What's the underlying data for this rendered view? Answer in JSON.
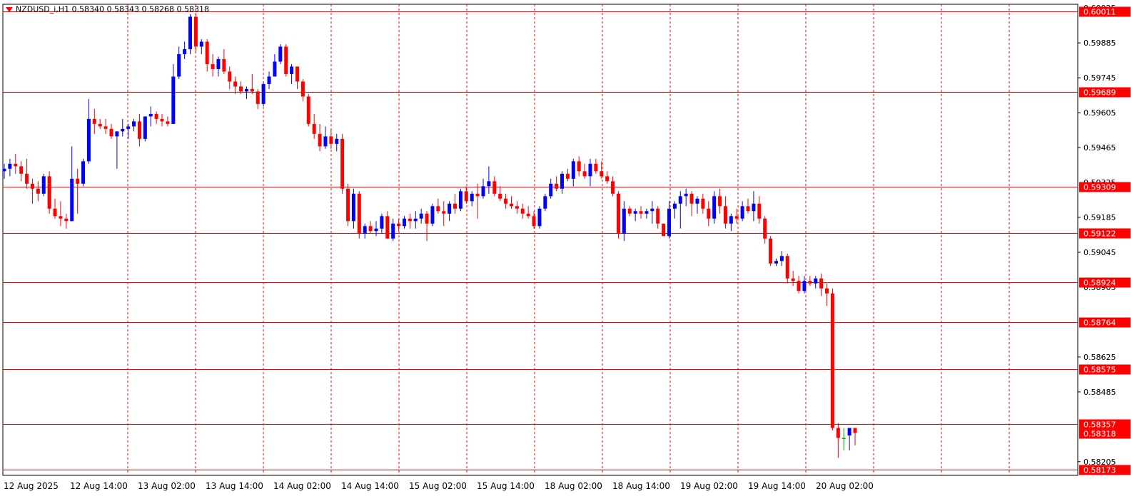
{
  "header": {
    "symbol_info": "NZDUSD_i,H1  0.58340 0.58343 0.58268 0.58318"
  },
  "colors": {
    "bull": "#0000ff",
    "bear": "#ff0000",
    "neutral": "#00aa00",
    "level_line": "#ff0000",
    "grid": "#ff0000",
    "axis_text": "#000000",
    "badge_bg": "#ff0000",
    "badge_text": "#ffffff"
  },
  "chart_data": {
    "type": "candlestick",
    "title": "",
    "ylim": [
      0.5815,
      0.6004
    ],
    "y_ticks": [
      "0.59885",
      "0.59745",
      "0.59605",
      "0.59465",
      "0.59185",
      "0.59045",
      "0.58625",
      "0.58485",
      "0.58205"
    ],
    "y_ticks_partial": [
      "0.60025",
      "0.59325",
      "0.58905"
    ],
    "x_ticks": [
      "12 Aug 2025",
      "12 Aug 14:00",
      "13 Aug 02:00",
      "13 Aug 14:00",
      "14 Aug 02:00",
      "14 Aug 14:00",
      "15 Aug 02:00",
      "15 Aug 14:00",
      "18 Aug 02:00",
      "18 Aug 14:00",
      "19 Aug 02:00",
      "19 Aug 14:00",
      "20 Aug 02:00"
    ],
    "horizontal_levels": [
      "0.60011",
      "0.59689",
      "0.59309",
      "0.59122",
      "0.58924",
      "0.58764",
      "0.58575",
      "0.58357",
      "0.58173"
    ],
    "current_price": "0.58318",
    "grid": "vertical dashed",
    "candles": [
      [
        0.5937,
        0.594,
        0.5934,
        0.5938
      ],
      [
        0.5938,
        0.5942,
        0.5935,
        0.594
      ],
      [
        0.594,
        0.5944,
        0.5936,
        0.5939
      ],
      [
        0.5939,
        0.5941,
        0.5933,
        0.5936
      ],
      [
        0.5936,
        0.5942,
        0.593,
        0.5932
      ],
      [
        0.5932,
        0.5934,
        0.5924,
        0.593
      ],
      [
        0.593,
        0.5933,
        0.5925,
        0.5928
      ],
      [
        0.5928,
        0.5936,
        0.5927,
        0.5935
      ],
      [
        0.5935,
        0.5937,
        0.592,
        0.5922
      ],
      [
        0.5922,
        0.5926,
        0.5918,
        0.5919
      ],
      [
        0.5919,
        0.5925,
        0.5915,
        0.5918
      ],
      [
        0.5918,
        0.592,
        0.5914,
        0.5917
      ],
      [
        0.5917,
        0.5947,
        0.5917,
        0.5934
      ],
      [
        0.5934,
        0.5938,
        0.592,
        0.5932
      ],
      [
        0.5932,
        0.5942,
        0.5931,
        0.5941
      ],
      [
        0.5941,
        0.5966,
        0.594,
        0.5958
      ],
      [
        0.5958,
        0.5962,
        0.5952,
        0.5956
      ],
      [
        0.5956,
        0.5958,
        0.5954,
        0.5955
      ],
      [
        0.5955,
        0.5958,
        0.5952,
        0.5954
      ],
      [
        0.5954,
        0.5956,
        0.595,
        0.5951
      ],
      [
        0.5951,
        0.5953,
        0.5938,
        0.5953
      ],
      [
        0.5953,
        0.5958,
        0.5951,
        0.5954
      ],
      [
        0.5954,
        0.5956,
        0.595,
        0.5955
      ],
      [
        0.5955,
        0.5958,
        0.5953,
        0.5957
      ],
      [
        0.5957,
        0.596,
        0.5947,
        0.595
      ],
      [
        0.595,
        0.5957,
        0.5949,
        0.5959
      ],
      [
        0.5959,
        0.5963,
        0.5955,
        0.596
      ],
      [
        0.596,
        0.5961,
        0.5956,
        0.5958
      ],
      [
        0.5958,
        0.596,
        0.5955,
        0.5957
      ],
      [
        0.5957,
        0.5959,
        0.5955,
        0.5956
      ],
      [
        0.5956,
        0.598,
        0.5956,
        0.5975
      ],
      [
        0.5975,
        0.5987,
        0.5974,
        0.5984
      ],
      [
        0.5984,
        0.5989,
        0.5982,
        0.5986
      ],
      [
        0.5986,
        0.6,
        0.5984,
        0.5999
      ],
      [
        0.5999,
        0.6,
        0.5985,
        0.5987
      ],
      [
        0.5987,
        0.599,
        0.5984,
        0.5989
      ],
      [
        0.5989,
        0.599,
        0.5977,
        0.598
      ],
      [
        0.598,
        0.5984,
        0.5975,
        0.5978
      ],
      [
        0.5978,
        0.5983,
        0.5975,
        0.5982
      ],
      [
        0.5982,
        0.5986,
        0.5976,
        0.5977
      ],
      [
        0.5977,
        0.5979,
        0.597,
        0.5973
      ],
      [
        0.5973,
        0.5975,
        0.5968,
        0.5971
      ],
      [
        0.5971,
        0.5973,
        0.5968,
        0.5969
      ],
      [
        0.5969,
        0.5971,
        0.5966,
        0.597
      ],
      [
        0.597,
        0.5976,
        0.5968,
        0.5969
      ],
      [
        0.5969,
        0.597,
        0.5962,
        0.5964
      ],
      [
        0.5964,
        0.5973,
        0.5963,
        0.5972
      ],
      [
        0.5972,
        0.5977,
        0.597,
        0.5975
      ],
      [
        0.5975,
        0.5984,
        0.5975,
        0.5981
      ],
      [
        0.5981,
        0.5988,
        0.598,
        0.5987
      ],
      [
        0.5987,
        0.5988,
        0.5975,
        0.5976
      ],
      [
        0.5976,
        0.598,
        0.5972,
        0.5979
      ],
      [
        0.5979,
        0.5979,
        0.597,
        0.5973
      ],
      [
        0.5973,
        0.5974,
        0.5965,
        0.5967
      ],
      [
        0.5967,
        0.5968,
        0.5955,
        0.5956
      ],
      [
        0.5956,
        0.596,
        0.595,
        0.5952
      ],
      [
        0.5952,
        0.5956,
        0.5945,
        0.5947
      ],
      [
        0.5947,
        0.5955,
        0.5946,
        0.5951
      ],
      [
        0.5951,
        0.5954,
        0.5946,
        0.5948
      ],
      [
        0.5948,
        0.5952,
        0.5945,
        0.595
      ],
      [
        0.595,
        0.5952,
        0.5928,
        0.593
      ],
      [
        0.593,
        0.5932,
        0.5915,
        0.5917
      ],
      [
        0.5917,
        0.593,
        0.5914,
        0.5928
      ],
      [
        0.5928,
        0.5929,
        0.591,
        0.5912
      ],
      [
        0.5912,
        0.5916,
        0.591,
        0.5915
      ],
      [
        0.5915,
        0.5917,
        0.5912,
        0.5913
      ],
      [
        0.5913,
        0.5917,
        0.5911,
        0.5914
      ],
      [
        0.5914,
        0.592,
        0.5912,
        0.5919
      ],
      [
        0.5919,
        0.5921,
        0.591,
        0.591
      ],
      [
        0.591,
        0.5918,
        0.5909,
        0.5916
      ],
      [
        0.5916,
        0.5918,
        0.5913,
        0.5915
      ],
      [
        0.5915,
        0.5919,
        0.5914,
        0.5918
      ],
      [
        0.5918,
        0.592,
        0.5914,
        0.5917
      ],
      [
        0.5917,
        0.5921,
        0.5914,
        0.5918
      ],
      [
        0.5918,
        0.5922,
        0.5916,
        0.592
      ],
      [
        0.592,
        0.5921,
        0.5909,
        0.5916
      ],
      [
        0.5916,
        0.5924,
        0.5915,
        0.5923
      ],
      [
        0.5923,
        0.5926,
        0.592,
        0.5921
      ],
      [
        0.5921,
        0.5925,
        0.5915,
        0.592
      ],
      [
        0.592,
        0.5925,
        0.5917,
        0.5924
      ],
      [
        0.5924,
        0.5928,
        0.592,
        0.5922
      ],
      [
        0.5922,
        0.593,
        0.5921,
        0.5929
      ],
      [
        0.5929,
        0.5931,
        0.5924,
        0.5925
      ],
      [
        0.5925,
        0.5929,
        0.5923,
        0.5928
      ],
      [
        0.5928,
        0.5932,
        0.5918,
        0.5927
      ],
      [
        0.5927,
        0.5934,
        0.5926,
        0.5931
      ],
      [
        0.5931,
        0.5939,
        0.5928,
        0.5933
      ],
      [
        0.5933,
        0.5935,
        0.5927,
        0.5928
      ],
      [
        0.5928,
        0.5931,
        0.5925,
        0.5926
      ],
      [
        0.5926,
        0.5928,
        0.5922,
        0.5924
      ],
      [
        0.5924,
        0.5927,
        0.5922,
        0.5923
      ],
      [
        0.5923,
        0.5925,
        0.592,
        0.5922
      ],
      [
        0.5922,
        0.5924,
        0.5918,
        0.592
      ],
      [
        0.592,
        0.5923,
        0.5918,
        0.5919
      ],
      [
        0.5919,
        0.5921,
        0.5914,
        0.5915
      ],
      [
        0.5915,
        0.5923,
        0.5914,
        0.5922
      ],
      [
        0.5922,
        0.5928,
        0.5921,
        0.5927
      ],
      [
        0.5927,
        0.5934,
        0.5926,
        0.5932
      ],
      [
        0.5932,
        0.5935,
        0.5929,
        0.593
      ],
      [
        0.593,
        0.5937,
        0.5928,
        0.5936
      ],
      [
        0.5936,
        0.5938,
        0.5933,
        0.5934
      ],
      [
        0.5934,
        0.5942,
        0.5931,
        0.5941
      ],
      [
        0.5941,
        0.5943,
        0.5935,
        0.5937
      ],
      [
        0.5937,
        0.594,
        0.5934,
        0.5935
      ],
      [
        0.5935,
        0.5942,
        0.5931,
        0.594
      ],
      [
        0.594,
        0.5942,
        0.5936,
        0.5937
      ],
      [
        0.5937,
        0.5941,
        0.5934,
        0.5935
      ],
      [
        0.5935,
        0.5937,
        0.5932,
        0.5933
      ],
      [
        0.5933,
        0.5935,
        0.5927,
        0.5928
      ],
      [
        0.5928,
        0.5929,
        0.591,
        0.5912
      ],
      [
        0.5912,
        0.5925,
        0.5909,
        0.5922
      ],
      [
        0.5922,
        0.5923,
        0.5919,
        0.592
      ],
      [
        0.592,
        0.5922,
        0.5917,
        0.5921
      ],
      [
        0.5921,
        0.5923,
        0.5918,
        0.592
      ],
      [
        0.592,
        0.5922,
        0.5918,
        0.5921
      ],
      [
        0.5921,
        0.5925,
        0.5916,
        0.5922
      ],
      [
        0.5922,
        0.5923,
        0.5914,
        0.5916
      ],
      [
        0.5916,
        0.5916,
        0.5911,
        0.5911
      ],
      [
        0.5911,
        0.5925,
        0.591,
        0.5922
      ],
      [
        0.5922,
        0.5925,
        0.5918,
        0.5924
      ],
      [
        0.5924,
        0.5929,
        0.5914,
        0.5927
      ],
      [
        0.5927,
        0.593,
        0.5923,
        0.5928
      ],
      [
        0.5928,
        0.5929,
        0.5919,
        0.5924
      ],
      [
        0.5924,
        0.5927,
        0.592,
        0.5926
      ],
      [
        0.5926,
        0.5928,
        0.592,
        0.5922
      ],
      [
        0.5922,
        0.5925,
        0.5915,
        0.5918
      ],
      [
        0.5918,
        0.5929,
        0.5916,
        0.5927
      ],
      [
        0.5927,
        0.593,
        0.592,
        0.5923
      ],
      [
        0.5923,
        0.5927,
        0.5914,
        0.5916
      ],
      [
        0.5916,
        0.592,
        0.5913,
        0.5919
      ],
      [
        0.5919,
        0.5922,
        0.5916,
        0.5918
      ],
      [
        0.5918,
        0.5925,
        0.5917,
        0.5923
      ],
      [
        0.5923,
        0.5926,
        0.592,
        0.5921
      ],
      [
        0.5921,
        0.5929,
        0.5917,
        0.5924
      ],
      [
        0.5924,
        0.5927,
        0.5916,
        0.5918
      ],
      [
        0.5918,
        0.5919,
        0.5908,
        0.591
      ],
      [
        0.591,
        0.5911,
        0.5899,
        0.59
      ],
      [
        0.59,
        0.5902,
        0.5899,
        0.5901
      ],
      [
        0.5901,
        0.5905,
        0.5899,
        0.5903
      ],
      [
        0.5903,
        0.5904,
        0.5892,
        0.5894
      ],
      [
        0.5894,
        0.5897,
        0.5891,
        0.5893
      ],
      [
        0.5893,
        0.5895,
        0.5888,
        0.5889
      ],
      [
        0.5889,
        0.5895,
        0.5888,
        0.5893
      ],
      [
        0.5893,
        0.5895,
        0.5891,
        0.5892
      ],
      [
        0.5892,
        0.5895,
        0.589,
        0.5894
      ],
      [
        0.5894,
        0.5896,
        0.5887,
        0.589
      ],
      [
        0.589,
        0.5892,
        0.5883,
        0.5888
      ],
      [
        0.5888,
        0.589,
        0.5833,
        0.5834
      ],
      [
        0.5834,
        0.5836,
        0.5822,
        0.583
      ],
      [
        0.583,
        0.5834,
        0.5825,
        0.583
      ],
      [
        0.5831,
        0.5834,
        0.5825,
        0.5834
      ],
      [
        0.5834,
        0.5834,
        0.5827,
        0.5832
      ]
    ]
  }
}
